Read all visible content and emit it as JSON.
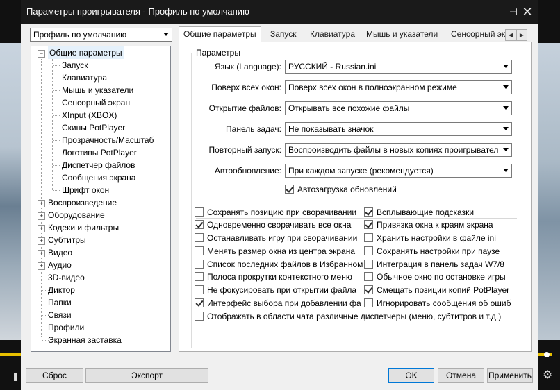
{
  "window": {
    "title": "Параметры проигрывателя - Профиль по умолчанию"
  },
  "profile_select": {
    "value": "Профиль по умолчанию"
  },
  "tree": {
    "items": [
      "Общие параметры",
      "Запуск",
      "Клавиатура",
      "Мышь и указатели",
      "Сенсорный экран",
      "XInput (XBOX)",
      "Скины PotPlayer",
      "Прозрачность/Масштаб",
      "Логотипы PotPlayer",
      "Диспетчер файлов",
      "Сообщения экрана",
      "Шрифт окон",
      "Воспроизведение",
      "Оборудование",
      "Кодеки и фильтры",
      "Субтитры",
      "Видео",
      "Аудио",
      "3D-видео",
      "Диктор",
      "Папки",
      "Связи",
      "Профили",
      "Экранная заставка"
    ]
  },
  "tabs": [
    "Общие параметры",
    "Запуск",
    "Клавиатура",
    "Мышь и указатели",
    "Сенсорный эк"
  ],
  "group": {
    "label": "Параметры",
    "rows": [
      {
        "label": "Язык (Language):",
        "value": "РУССКИЙ - Russian.ini"
      },
      {
        "label": "Поверх всех окон:",
        "value": "Поверх всех окон в полноэкранном режиме"
      },
      {
        "label": "Открытие файлов:",
        "value": "Открывать все похожие файлы"
      },
      {
        "label": "Панель задач:",
        "value": "Не показывать значок"
      },
      {
        "label": "Повторный запуск:",
        "value": "Воспроизводить файлы в новых копиях проигрывател"
      },
      {
        "label": "Автообновление:",
        "value": "При каждом запуске (рекомендуется)"
      }
    ],
    "auto_update_check": {
      "label": "Автозагрузка обновлений",
      "checked": true
    }
  },
  "checks_left": [
    {
      "label": "Сохранять позицию при сворачивании",
      "checked": false
    },
    {
      "label": "Одновременно сворачивать все окна",
      "checked": true
    },
    {
      "label": "Останавливать игру при сворачивании",
      "checked": false
    },
    {
      "label": "Менять размер окна из центра экрана",
      "checked": false
    },
    {
      "label": "Список последних файлов в Избранном",
      "checked": false
    },
    {
      "label": "Полоса прокрутки контекстного меню",
      "checked": false
    },
    {
      "label": "Не фокусировать при открытии файла",
      "checked": false
    },
    {
      "label": "Интерфейс выбора при добавлении фай",
      "checked": true
    }
  ],
  "checks_right": [
    {
      "label": "Всплывающие подсказки",
      "checked": true
    },
    {
      "label": "Привязка окна к краям экрана",
      "checked": true
    },
    {
      "label": "Хранить настройки в файле ini",
      "checked": false
    },
    {
      "label": "Сохранять настройки при паузе",
      "checked": false
    },
    {
      "label": "Интеграция в панель задач W7/8",
      "checked": false
    },
    {
      "label": "Обычное окно по остановке игры",
      "checked": false
    },
    {
      "label": "Смещать позиции копий PotPlayer",
      "checked": true
    },
    {
      "label": "Игнорировать сообщения об ошиб",
      "checked": false
    }
  ],
  "check_wide": {
    "label": "Отображать в области чата различные диспетчеры (меню, субтитров и т.д.)",
    "checked": false
  },
  "buttons": {
    "reset": "Сброс",
    "export": "Экспорт",
    "ok": "OK",
    "cancel": "Отмена",
    "apply": "Применить"
  },
  "colors": {
    "title_bg": "#1a1a1a",
    "client_bg": "#f0f0f0",
    "seek": "#e8c000"
  }
}
